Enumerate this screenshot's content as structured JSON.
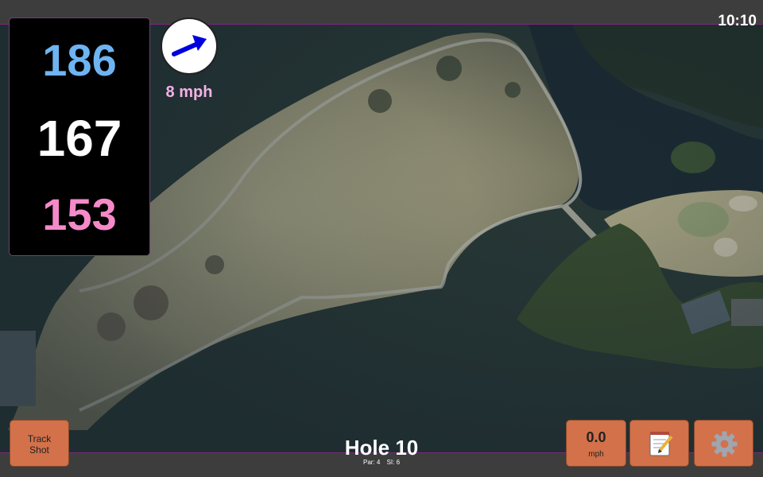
{
  "status": {
    "time": "10:10"
  },
  "yardage": {
    "back": "186",
    "middle": "167",
    "front": "153"
  },
  "wind": {
    "speed": "8 mph",
    "icon": "wind-arrow-icon",
    "color": "#0000dd"
  },
  "hole": {
    "title": "Hole 10",
    "par": "Par: 4",
    "stroke_index": "SI: 6"
  },
  "buttons": {
    "track_shot": "Track Shot",
    "speed_value": "0.0",
    "speed_unit": "mph",
    "notes_icon": "notepad-icon",
    "settings_icon": "gear-icon"
  },
  "colors": {
    "back": "#6eb4f2",
    "middle": "#ffffff",
    "front": "#f58ac9",
    "button": "#d2714a",
    "frame_border": "#7a2a7a"
  }
}
